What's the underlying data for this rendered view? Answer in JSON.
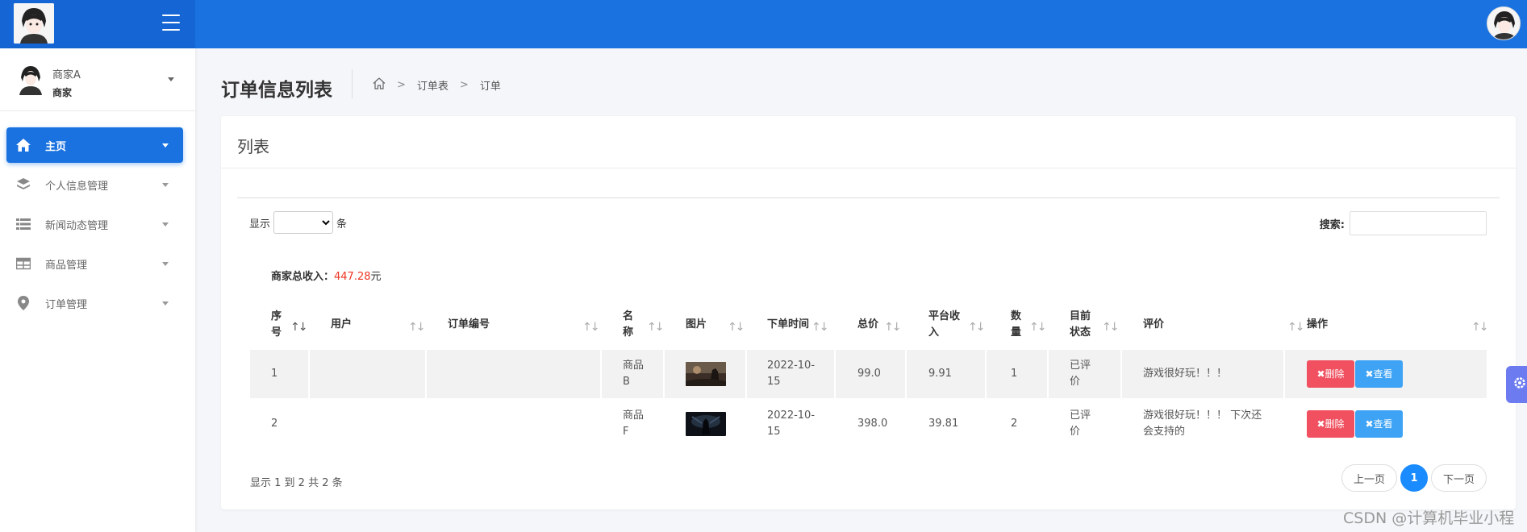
{
  "header": {
    "menu_toggle": "menu-toggle"
  },
  "sidebar": {
    "user": {
      "name": "商家A",
      "role": "商家"
    },
    "items": [
      {
        "label": "主页",
        "icon": "home-icon",
        "active": true
      },
      {
        "label": "个人信息管理",
        "icon": "layers-icon",
        "active": false
      },
      {
        "label": "新闻动态管理",
        "icon": "list-icon",
        "active": false
      },
      {
        "label": "商品管理",
        "icon": "table-icon",
        "active": false
      },
      {
        "label": "订单管理",
        "icon": "location-pin-icon",
        "active": false
      }
    ]
  },
  "page": {
    "title": "订单信息列表",
    "breadcrumb": [
      "订单表",
      "订单"
    ]
  },
  "card": {
    "title": "列表",
    "length": {
      "prefix": "显示",
      "suffix": "条"
    },
    "search": {
      "label": "搜索:",
      "value": ""
    },
    "income": {
      "label": "商家总收入：",
      "value": "447.28",
      "unit": "元"
    }
  },
  "table": {
    "columns": [
      "序号",
      "用户",
      "订单编号",
      "名称",
      "图片",
      "下单时间",
      "总价",
      "平台收入",
      "数量",
      "目前状态",
      "评价",
      "操作"
    ],
    "rows": [
      {
        "index": "1",
        "user": "",
        "order_no": "",
        "name": "商品B",
        "image": "game-thumbnail",
        "time": "2022-10-15",
        "total": "99.0",
        "platform": "9.91",
        "qty": "1",
        "status": "已评价",
        "review": "游戏很好玩！！！"
      },
      {
        "index": "2",
        "user": "",
        "order_no": "",
        "name": "商品F",
        "image": "game-thumbnail",
        "time": "2022-10-15",
        "total": "398.0",
        "platform": "39.81",
        "qty": "2",
        "status": "已评价",
        "review": "游戏很好玩！！！ 下次还会支持的"
      }
    ],
    "actions": {
      "delete": "删除",
      "view": "查看"
    }
  },
  "footer": {
    "info": "显示 1 到 2 共 2 条",
    "pager": {
      "prev": "上一页",
      "current": "1",
      "next": "下一页"
    }
  },
  "watermark": "CSDN @计算机毕业小程",
  "colors": {
    "primary": "#1a72e0",
    "danger": "#f0505f",
    "info": "#3ea3f5",
    "income": "#ee3322"
  }
}
